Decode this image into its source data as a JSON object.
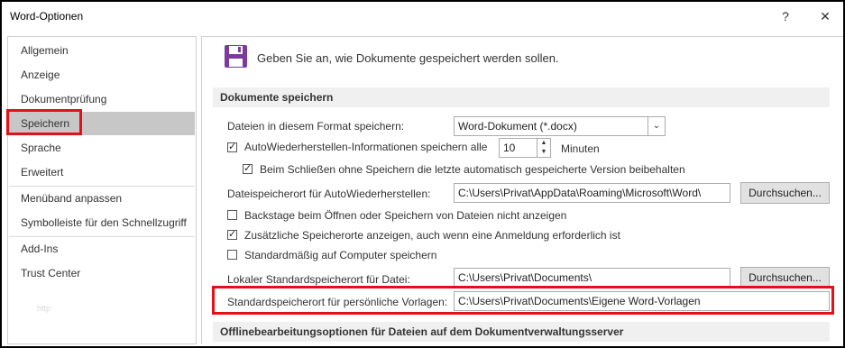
{
  "window": {
    "title": "Word-Optionen",
    "help": "?",
    "close": "✕"
  },
  "sidebar": {
    "items": [
      {
        "label": "Allgemein"
      },
      {
        "label": "Anzeige"
      },
      {
        "label": "Dokumentprüfung"
      },
      {
        "label": "Speichern"
      },
      {
        "label": "Sprache"
      },
      {
        "label": "Erweitert"
      },
      {
        "label": "Menüband anpassen"
      },
      {
        "label": "Symbolleiste für den Schnellzugriff"
      },
      {
        "label": "Add-Ins"
      },
      {
        "label": "Trust Center"
      }
    ],
    "active": "Speichern",
    "watermark": "http"
  },
  "main": {
    "header": "Geben Sie an, wie Dokumente gespeichert werden sollen.",
    "section1": "Dokumente speichern",
    "format_label": "Dateien in diesem Format speichern:",
    "format_value": "Word-Dokument (*.docx)",
    "autorecover_label": "AutoWiederherstellen-Informationen speichern alle",
    "autorecover_minutes": "10",
    "minutes_label": "Minuten",
    "keep_last_label": "Beim Schließen ohne Speichern die letzte automatisch gespeicherte Version beibehalten",
    "autorecover_path_label": "Dateispeicherort für AutoWiederherstellen:",
    "autorecover_path": "C:\\Users\\Privat\\AppData\\Roaming\\Microsoft\\Word\\",
    "browse": "Durchsuchen...",
    "backstage_label": "Backstage beim Öffnen oder Speichern von Dateien nicht anzeigen",
    "extra_locations_label": "Zusätzliche Speicherorte anzeigen, auch wenn eine Anmeldung erforderlich ist",
    "default_computer_label": "Standardmäßig auf Computer speichern",
    "local_default_label": "Lokaler Standardspeicherort für Datei:",
    "local_default_path": "C:\\Users\\Privat\\Documents\\",
    "templates_label": "Standardspeicherort für persönliche Vorlagen:",
    "templates_path": "C:\\Users\\Privat\\Documents\\Eigene Word-Vorlagen",
    "section2": "Offlinebearbeitungsoptionen für Dateien auf dem Dokumentverwaltungsserver",
    "checks": {
      "autorecover": true,
      "keep_last": true,
      "backstage": false,
      "extra_locations": true,
      "default_computer": false
    }
  },
  "colors": {
    "highlight": "#e3101a",
    "save_icon": "#7a3b9c",
    "active_nav": "#c7c7c7"
  }
}
